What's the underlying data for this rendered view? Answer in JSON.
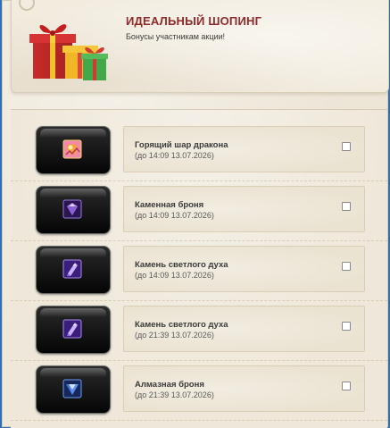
{
  "header": {
    "title": "ИДЕАЛЬНЫЙ ШОПИНГ",
    "subtitle": "Бонусы участникам акции!"
  },
  "items": [
    {
      "name": "Горящий шар дракона",
      "expiry": "(до 14:09 13.07.2026)",
      "icon": "dragon-fire-orb-icon",
      "checked": false
    },
    {
      "name": "Каменная броня",
      "expiry": "(до 14:09 13.07.2026)",
      "icon": "stone-armor-gem-icon",
      "checked": false
    },
    {
      "name": "Камень светлого духа",
      "expiry": "(до 14:09 13.07.2026)",
      "icon": "light-spirit-stone-icon",
      "checked": false
    },
    {
      "name": "Камень светлого духа",
      "expiry": "(до 21:39 13.07.2026)",
      "icon": "light-spirit-stone-icon",
      "checked": false
    },
    {
      "name": "Алмазная броня",
      "expiry": "(до 21:39 13.07.2026)",
      "icon": "diamond-armor-gem-icon",
      "checked": false
    }
  ],
  "colors": {
    "title": "#8f2a2a",
    "page_background": "#efe8da",
    "outer_border": "#2f6fb4"
  }
}
